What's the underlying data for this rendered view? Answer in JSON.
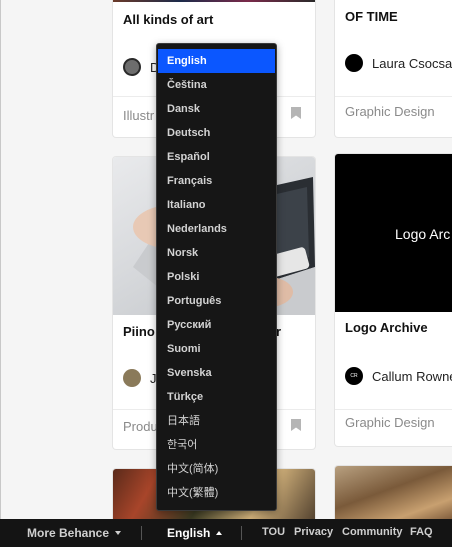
{
  "cards": {
    "c1": {
      "title": "All kinds of art",
      "owner": "D",
      "field": "Illustr"
    },
    "c2": {
      "title": "OF TIME",
      "owner": "Laura Csocsa",
      "field": "Graphic Design"
    },
    "c3": {
      "title": "Piino",
      "title_tail": "r",
      "owner": "J",
      "field": "Produ"
    },
    "c4": {
      "thumb_text": "Logo Arc",
      "title": "Logo Archive",
      "owner": "Callum Rowne",
      "owner_avatar": "CR",
      "field": "Graphic Design"
    }
  },
  "language_menu": {
    "items": [
      {
        "label": "English",
        "selected": true
      },
      {
        "label": "Čeština"
      },
      {
        "label": "Dansk"
      },
      {
        "label": "Deutsch"
      },
      {
        "label": "Español"
      },
      {
        "label": "Français"
      },
      {
        "label": "Italiano"
      },
      {
        "label": "Nederlands"
      },
      {
        "label": "Norsk"
      },
      {
        "label": "Polski"
      },
      {
        "label": "Português"
      },
      {
        "label": "Русский"
      },
      {
        "label": "Suomi"
      },
      {
        "label": "Svenska"
      },
      {
        "label": "Türkçe"
      },
      {
        "label": "日本語"
      },
      {
        "label": "한국어"
      },
      {
        "label": "中文(简体)"
      },
      {
        "label": "中文(繁體)"
      }
    ]
  },
  "footer": {
    "more": "More Behance",
    "language": "English",
    "links": [
      "TOU",
      "Privacy",
      "Community",
      "FAQ"
    ]
  },
  "colors": {
    "menu_selected": "#0b57ff",
    "footer_bg": "#141414",
    "menu_bg": "#161616"
  }
}
